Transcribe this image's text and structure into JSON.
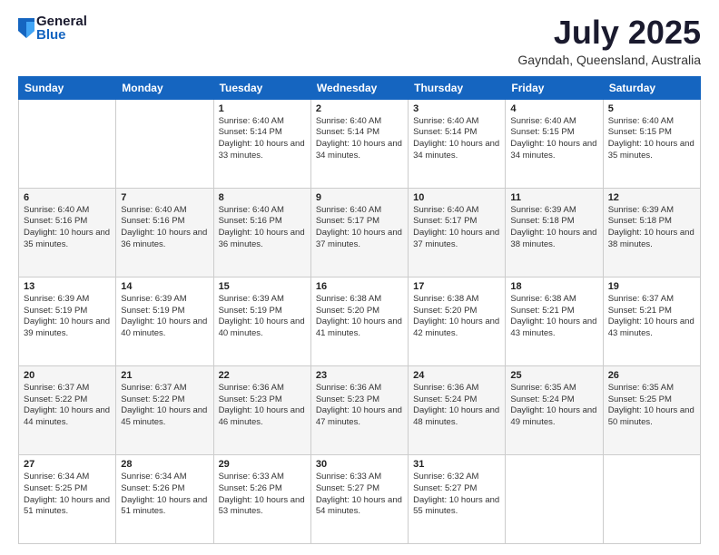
{
  "header": {
    "logo_general": "General",
    "logo_blue": "Blue",
    "title": "July 2025",
    "location": "Gayndah, Queensland, Australia"
  },
  "calendar": {
    "days_of_week": [
      "Sunday",
      "Monday",
      "Tuesday",
      "Wednesday",
      "Thursday",
      "Friday",
      "Saturday"
    ],
    "weeks": [
      [
        {
          "day": "",
          "info": ""
        },
        {
          "day": "",
          "info": ""
        },
        {
          "day": "1",
          "info": "Sunrise: 6:40 AM\nSunset: 5:14 PM\nDaylight: 10 hours and 33 minutes."
        },
        {
          "day": "2",
          "info": "Sunrise: 6:40 AM\nSunset: 5:14 PM\nDaylight: 10 hours and 34 minutes."
        },
        {
          "day": "3",
          "info": "Sunrise: 6:40 AM\nSunset: 5:14 PM\nDaylight: 10 hours and 34 minutes."
        },
        {
          "day": "4",
          "info": "Sunrise: 6:40 AM\nSunset: 5:15 PM\nDaylight: 10 hours and 34 minutes."
        },
        {
          "day": "5",
          "info": "Sunrise: 6:40 AM\nSunset: 5:15 PM\nDaylight: 10 hours and 35 minutes."
        }
      ],
      [
        {
          "day": "6",
          "info": "Sunrise: 6:40 AM\nSunset: 5:16 PM\nDaylight: 10 hours and 35 minutes."
        },
        {
          "day": "7",
          "info": "Sunrise: 6:40 AM\nSunset: 5:16 PM\nDaylight: 10 hours and 36 minutes."
        },
        {
          "day": "8",
          "info": "Sunrise: 6:40 AM\nSunset: 5:16 PM\nDaylight: 10 hours and 36 minutes."
        },
        {
          "day": "9",
          "info": "Sunrise: 6:40 AM\nSunset: 5:17 PM\nDaylight: 10 hours and 37 minutes."
        },
        {
          "day": "10",
          "info": "Sunrise: 6:40 AM\nSunset: 5:17 PM\nDaylight: 10 hours and 37 minutes."
        },
        {
          "day": "11",
          "info": "Sunrise: 6:39 AM\nSunset: 5:18 PM\nDaylight: 10 hours and 38 minutes."
        },
        {
          "day": "12",
          "info": "Sunrise: 6:39 AM\nSunset: 5:18 PM\nDaylight: 10 hours and 38 minutes."
        }
      ],
      [
        {
          "day": "13",
          "info": "Sunrise: 6:39 AM\nSunset: 5:19 PM\nDaylight: 10 hours and 39 minutes."
        },
        {
          "day": "14",
          "info": "Sunrise: 6:39 AM\nSunset: 5:19 PM\nDaylight: 10 hours and 40 minutes."
        },
        {
          "day": "15",
          "info": "Sunrise: 6:39 AM\nSunset: 5:19 PM\nDaylight: 10 hours and 40 minutes."
        },
        {
          "day": "16",
          "info": "Sunrise: 6:38 AM\nSunset: 5:20 PM\nDaylight: 10 hours and 41 minutes."
        },
        {
          "day": "17",
          "info": "Sunrise: 6:38 AM\nSunset: 5:20 PM\nDaylight: 10 hours and 42 minutes."
        },
        {
          "day": "18",
          "info": "Sunrise: 6:38 AM\nSunset: 5:21 PM\nDaylight: 10 hours and 43 minutes."
        },
        {
          "day": "19",
          "info": "Sunrise: 6:37 AM\nSunset: 5:21 PM\nDaylight: 10 hours and 43 minutes."
        }
      ],
      [
        {
          "day": "20",
          "info": "Sunrise: 6:37 AM\nSunset: 5:22 PM\nDaylight: 10 hours and 44 minutes."
        },
        {
          "day": "21",
          "info": "Sunrise: 6:37 AM\nSunset: 5:22 PM\nDaylight: 10 hours and 45 minutes."
        },
        {
          "day": "22",
          "info": "Sunrise: 6:36 AM\nSunset: 5:23 PM\nDaylight: 10 hours and 46 minutes."
        },
        {
          "day": "23",
          "info": "Sunrise: 6:36 AM\nSunset: 5:23 PM\nDaylight: 10 hours and 47 minutes."
        },
        {
          "day": "24",
          "info": "Sunrise: 6:36 AM\nSunset: 5:24 PM\nDaylight: 10 hours and 48 minutes."
        },
        {
          "day": "25",
          "info": "Sunrise: 6:35 AM\nSunset: 5:24 PM\nDaylight: 10 hours and 49 minutes."
        },
        {
          "day": "26",
          "info": "Sunrise: 6:35 AM\nSunset: 5:25 PM\nDaylight: 10 hours and 50 minutes."
        }
      ],
      [
        {
          "day": "27",
          "info": "Sunrise: 6:34 AM\nSunset: 5:25 PM\nDaylight: 10 hours and 51 minutes."
        },
        {
          "day": "28",
          "info": "Sunrise: 6:34 AM\nSunset: 5:26 PM\nDaylight: 10 hours and 51 minutes."
        },
        {
          "day": "29",
          "info": "Sunrise: 6:33 AM\nSunset: 5:26 PM\nDaylight: 10 hours and 53 minutes."
        },
        {
          "day": "30",
          "info": "Sunrise: 6:33 AM\nSunset: 5:27 PM\nDaylight: 10 hours and 54 minutes."
        },
        {
          "day": "31",
          "info": "Sunrise: 6:32 AM\nSunset: 5:27 PM\nDaylight: 10 hours and 55 minutes."
        },
        {
          "day": "",
          "info": ""
        },
        {
          "day": "",
          "info": ""
        }
      ]
    ]
  }
}
